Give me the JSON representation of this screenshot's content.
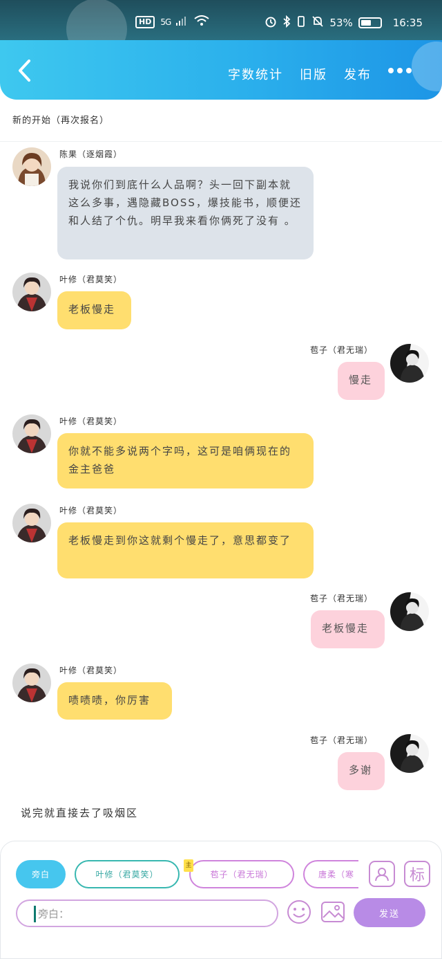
{
  "status_bar": {
    "hd": "HD",
    "network": "5G",
    "battery_percent": "53%",
    "battery_level": 0.53,
    "time": "16:35"
  },
  "header": {
    "back_icon": "chevron-left-icon",
    "actions": [
      "字数统计",
      "旧版",
      "发布"
    ],
    "more_icon": "more-dots-icon"
  },
  "chat": {
    "title": "新的开始（再次报名）",
    "messages": [
      {
        "side": "left",
        "sender": "陈果（逐烟霞）",
        "text": "我说你们到底什么人品啊？头一回下副本就这么多事，遇隐藏BOSS，爆技能书，顺便还和人结了个仇。明早我来看你俩死了没有 。",
        "color": "gray"
      },
      {
        "side": "left",
        "sender": "叶修（君莫笑）",
        "text": "老板慢走",
        "color": "yellow"
      },
      {
        "side": "right",
        "sender": "苞子（君无瑞）",
        "text": "慢走",
        "color": "pink"
      },
      {
        "side": "left",
        "sender": "叶修（君莫笑）",
        "text": "你就不能多说两个字吗，这可是咱俩现在的金主爸爸",
        "color": "yellow"
      },
      {
        "side": "left",
        "sender": "叶修（君莫笑）",
        "text": "老板慢走到你这就剩个慢走了，意思都变了",
        "color": "yellow"
      },
      {
        "side": "right",
        "sender": "苞子（君无瑞）",
        "text": "老板慢走",
        "color": "pink"
      },
      {
        "side": "left",
        "sender": "叶修（君莫笑）",
        "text": "啧啧啧，你厉害",
        "color": "yellow"
      },
      {
        "side": "right",
        "sender": "苞子（君无瑞）",
        "text": "多谢",
        "color": "pink"
      }
    ],
    "narration": "说完就直接去了吸烟区"
  },
  "composer": {
    "chips": {
      "narration": "旁白",
      "yexiu": "叶修（君莫笑）",
      "baojiao": "苞子（君无瑞）",
      "tang": "唐柔（寒"
    },
    "main_tag": "主",
    "tool_icons": [
      "character-card-icon",
      "tag-icon"
    ],
    "tag_label": "标",
    "input_placeholder": "旁白：",
    "emoji_icon": "smiley-icon",
    "image_icon": "image-icon",
    "send_label": "发送"
  },
  "colors": {
    "header_start": "#3ec8ef",
    "header_end": "#1d95e6",
    "bubble_gray": "#dde3ea",
    "bubble_yellow": "#ffde6f",
    "bubble_pink": "#fdd2dc",
    "send_purple": "#b88be6"
  }
}
